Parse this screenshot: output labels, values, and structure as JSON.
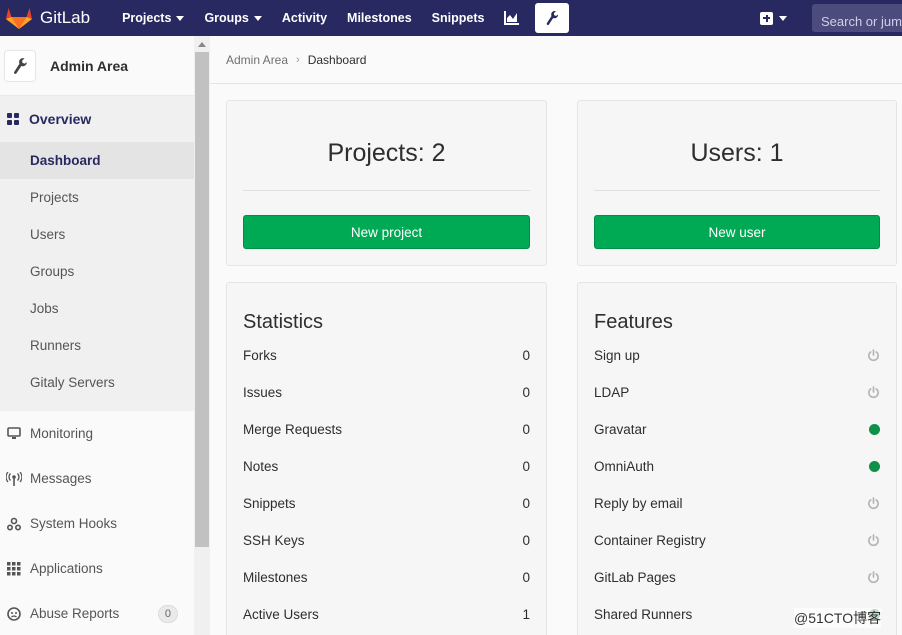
{
  "topbar": {
    "brand": "GitLab",
    "nav": [
      {
        "label": "Projects",
        "caret": true
      },
      {
        "label": "Groups",
        "caret": true
      },
      {
        "label": "Activity",
        "caret": false
      },
      {
        "label": "Milestones",
        "caret": false
      },
      {
        "label": "Snippets",
        "caret": false
      }
    ],
    "search_placeholder": "Search or jump to…"
  },
  "sidebar": {
    "title": "Admin Area",
    "overview_label": "Overview",
    "overview_items": [
      "Dashboard",
      "Projects",
      "Users",
      "Groups",
      "Jobs",
      "Runners",
      "Gitaly Servers"
    ],
    "items": [
      {
        "label": "Monitoring",
        "icon": "monitor-icon"
      },
      {
        "label": "Messages",
        "icon": "broadcast-icon"
      },
      {
        "label": "System Hooks",
        "icon": "hook-icon"
      },
      {
        "label": "Applications",
        "icon": "apps-grid-icon"
      },
      {
        "label": "Abuse Reports",
        "icon": "abuse-report-icon",
        "badge": "0"
      }
    ]
  },
  "breadcrumb": {
    "parent": "Admin Area",
    "current": "Dashboard"
  },
  "projects_card": {
    "title": "Projects: 2",
    "button": "New project"
  },
  "users_card": {
    "title": "Users: 1",
    "button": "New user"
  },
  "statistics": {
    "title": "Statistics",
    "rows": [
      {
        "label": "Forks",
        "value": "0"
      },
      {
        "label": "Issues",
        "value": "0"
      },
      {
        "label": "Merge Requests",
        "value": "0"
      },
      {
        "label": "Notes",
        "value": "0"
      },
      {
        "label": "Snippets",
        "value": "0"
      },
      {
        "label": "SSH Keys",
        "value": "0"
      },
      {
        "label": "Milestones",
        "value": "0"
      },
      {
        "label": "Active Users",
        "value": "1"
      }
    ]
  },
  "features": {
    "title": "Features",
    "rows": [
      {
        "label": "Sign up",
        "enabled": false
      },
      {
        "label": "LDAP",
        "enabled": false
      },
      {
        "label": "Gravatar",
        "enabled": true
      },
      {
        "label": "OmniAuth",
        "enabled": true
      },
      {
        "label": "Reply by email",
        "enabled": false
      },
      {
        "label": "Container Registry",
        "enabled": false
      },
      {
        "label": "GitLab Pages",
        "enabled": false
      },
      {
        "label": "Shared Runners",
        "enabled": true
      }
    ]
  },
  "watermark": "@51CTO博客",
  "colors": {
    "navbar": "#292961",
    "success": "#00aa55",
    "enabled_dot": "#0e8f4a"
  }
}
